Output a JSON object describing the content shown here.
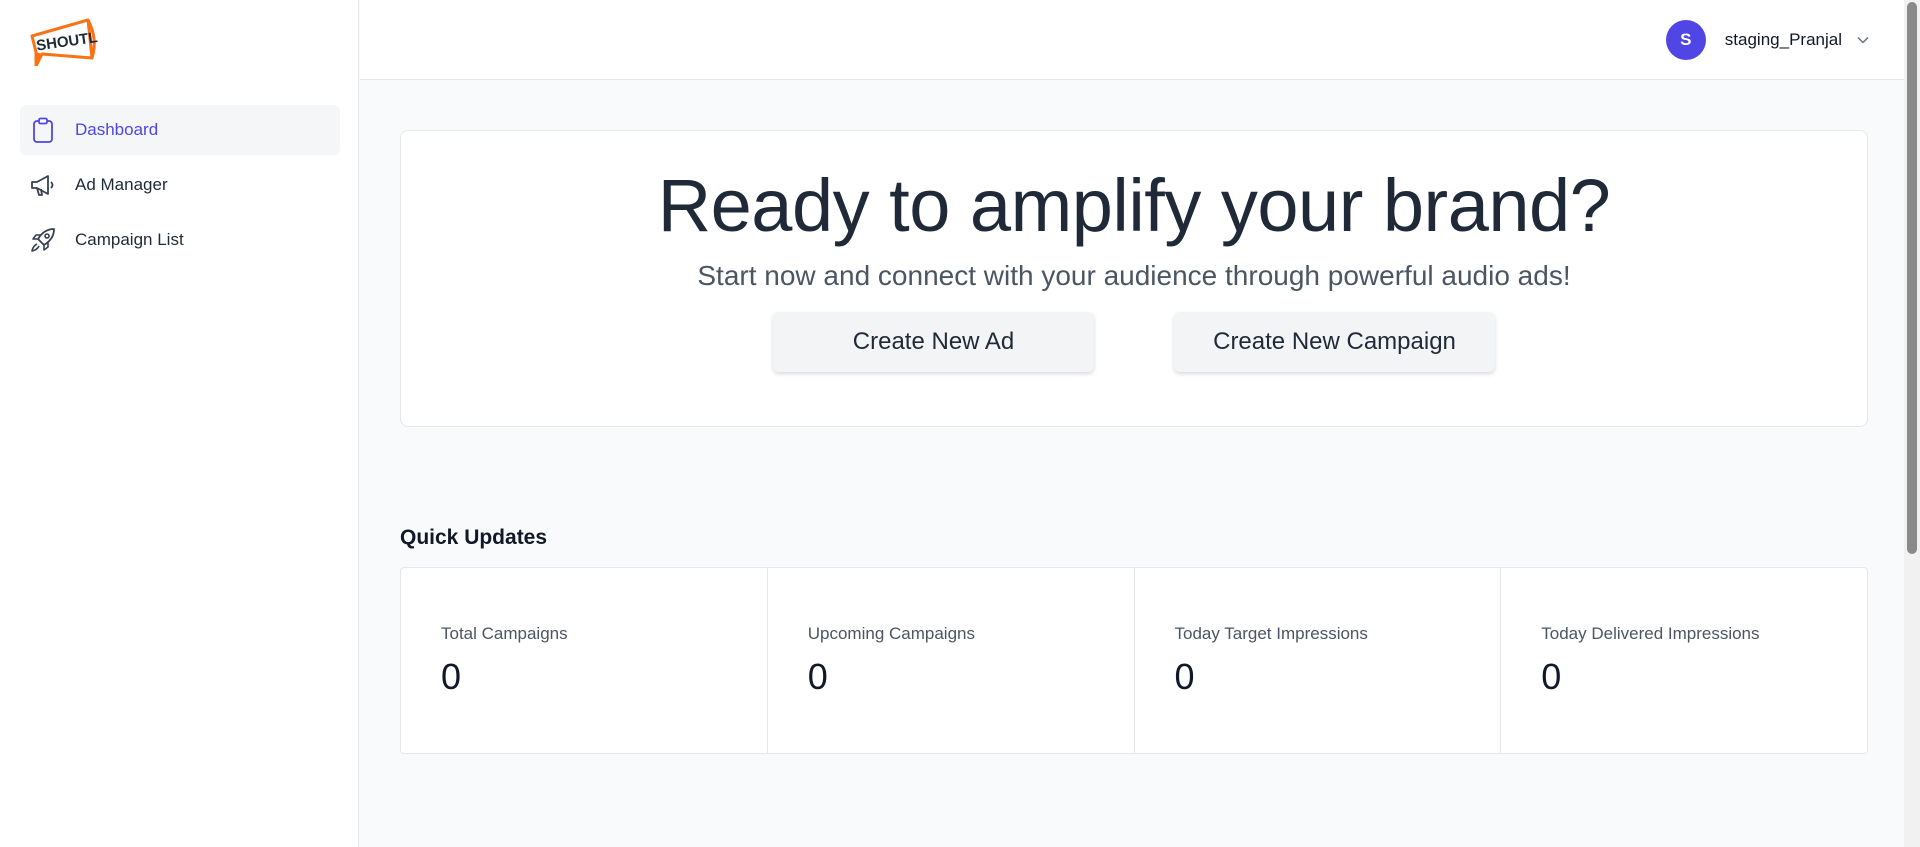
{
  "brand": {
    "logo_text": "SHOUTL",
    "accent": "#4f46e5",
    "logo_color": "#f97316"
  },
  "sidebar": {
    "items": [
      {
        "label": "Dashboard",
        "icon": "clipboard-icon",
        "active": true
      },
      {
        "label": "Ad Manager",
        "icon": "megaphone-icon",
        "active": false
      },
      {
        "label": "Campaign List",
        "icon": "rocket-icon",
        "active": false
      }
    ]
  },
  "header": {
    "user": {
      "initial": "S",
      "name": "staging_Pranjal",
      "dropdown_icon": "chevron-down-icon"
    }
  },
  "hero": {
    "title": "Ready to amplify your brand?",
    "subtitle": "Start now and connect with your audience through powerful audio ads!",
    "create_ad_label": "Create New Ad",
    "create_campaign_label": "Create New Campaign"
  },
  "quick_updates": {
    "title": "Quick Updates",
    "stats": [
      {
        "label": "Total Campaigns",
        "value": "0"
      },
      {
        "label": "Upcoming Campaigns",
        "value": "0"
      },
      {
        "label": "Today Target Impressions",
        "value": "0"
      },
      {
        "label": "Today Delivered Impressions",
        "value": "0"
      }
    ]
  }
}
